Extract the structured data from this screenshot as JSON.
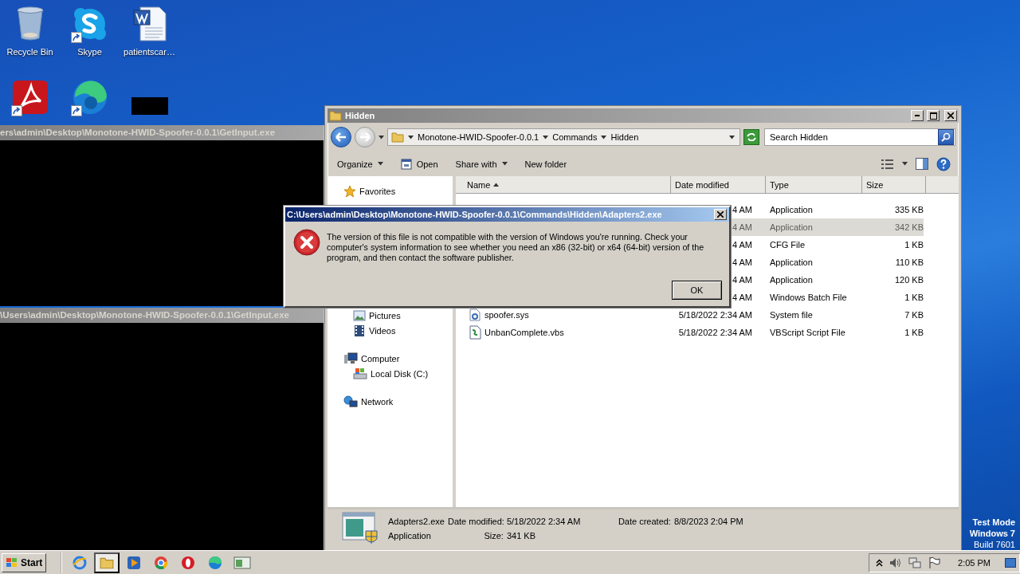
{
  "desktop": {
    "icons": [
      {
        "kind": "recycle-bin",
        "label": "Recycle Bin",
        "shortcut": false
      },
      {
        "kind": "skype",
        "label": "Skype",
        "shortcut": true
      },
      {
        "kind": "word-document",
        "label": "patientscar…",
        "shortcut": false
      },
      {
        "kind": "pdf",
        "shortcut": true
      },
      {
        "kind": "edge",
        "shortcut": true
      },
      {
        "kind": "blacked-out",
        "shortcut": false
      }
    ],
    "notice": [
      "Test Mode",
      "Windows 7",
      "Build 7601"
    ]
  },
  "consoles": [
    {
      "title": "ers\\admin\\Desktop\\Monotone-HWID-Spoofer-0.0.1\\GetInput.exe"
    },
    {
      "title": "\\Users\\admin\\Desktop\\Monotone-HWID-Spoofer-0.0.1\\GetInput.exe"
    }
  ],
  "explorer": {
    "title": "Hidden",
    "breadcrumbs": [
      "Monotone-HWID-Spoofer-0.0.1",
      "Commands",
      "Hidden"
    ],
    "search": {
      "placeholder": "Search Hidden"
    },
    "toolbar": [
      {
        "kind": "menu",
        "label": "Organize"
      },
      {
        "kind": "icon-button",
        "label": "Open"
      },
      {
        "kind": "menu",
        "label": "Share with"
      },
      {
        "kind": "plain",
        "label": "New folder"
      }
    ],
    "sidebar": [
      {
        "kind": "favorites",
        "label": "Favorites"
      },
      {
        "children": [
          {
            "kind": "pictures",
            "label": "Pictures"
          },
          {
            "kind": "videos",
            "label": "Videos"
          }
        ]
      },
      {
        "kind": "computer",
        "label": "Computer",
        "children": [
          {
            "kind": "disk",
            "label": "Local Disk (C:)"
          }
        ]
      },
      {
        "kind": "network",
        "label": "Network"
      }
    ],
    "columns": [
      {
        "label": "Name",
        "sorted": true
      },
      {
        "label": "Date modified",
        "sorted": false
      },
      {
        "label": "Type",
        "sorted": false
      },
      {
        "label": "Size",
        "sorted": false
      }
    ],
    "rows": [
      {
        "date": "4 AM",
        "type": "Application",
        "size": "335 KB",
        "selected": false
      },
      {
        "date": "4 AM",
        "type": "Application",
        "size": "342 KB",
        "selected": true
      },
      {
        "date": "4 AM",
        "type": "CFG File",
        "size": "1 KB",
        "selected": false
      },
      {
        "date": "4 AM",
        "type": "Application",
        "size": "110 KB",
        "selected": false
      },
      {
        "date": "4 AM",
        "type": "Application",
        "size": "120 KB",
        "selected": false
      },
      {
        "date": "4 AM",
        "type": "Windows Batch File",
        "size": "1 KB",
        "selected": false
      },
      {
        "kind": "system-file",
        "name": "spoofer.sys",
        "date": "5/18/2022 2:34 AM",
        "type": "System file",
        "size": "7 KB",
        "selected": false
      },
      {
        "kind": "script",
        "name": "UnbanComplete.vbs",
        "date": "5/18/2022 2:34 AM",
        "type": "VBScript Script File",
        "size": "1 KB",
        "selected": false
      }
    ],
    "details": {
      "name": "Adapters2.exe",
      "type": "Application",
      "fields": [
        {
          "label": "Date modified:",
          "value": "5/18/2022 2:34 AM"
        },
        {
          "label": "Size:",
          "value": "341 KB"
        },
        {
          "label": "Date created:",
          "value": "8/8/2023 2:04 PM"
        }
      ]
    }
  },
  "dialog": {
    "title": "C:\\Users\\admin\\Desktop\\Monotone-HWID-Spoofer-0.0.1\\Commands\\Hidden\\Adapters2.exe",
    "message": "The version of this file is not compatible with the version of Windows you're running. Check your computer's system information to see whether you need an x86 (32-bit) or x64 (64-bit) version of the program, and then contact the software publisher.",
    "buttons": [
      "OK"
    ]
  },
  "taskbar": {
    "start": "Start",
    "apps": [
      {
        "kind": "ie",
        "selected": false
      },
      {
        "kind": "explorer",
        "selected": true
      },
      {
        "kind": "media",
        "selected": false
      },
      {
        "kind": "chrome",
        "selected": false
      },
      {
        "kind": "opera",
        "selected": false
      },
      {
        "kind": "edge",
        "selected": false
      },
      {
        "kind": "window",
        "selected": false
      }
    ],
    "tray": [
      {
        "kind": "chevron"
      },
      {
        "kind": "speaker"
      },
      {
        "kind": "network"
      },
      {
        "kind": "flag"
      }
    ],
    "clock": "2:05 PM"
  }
}
